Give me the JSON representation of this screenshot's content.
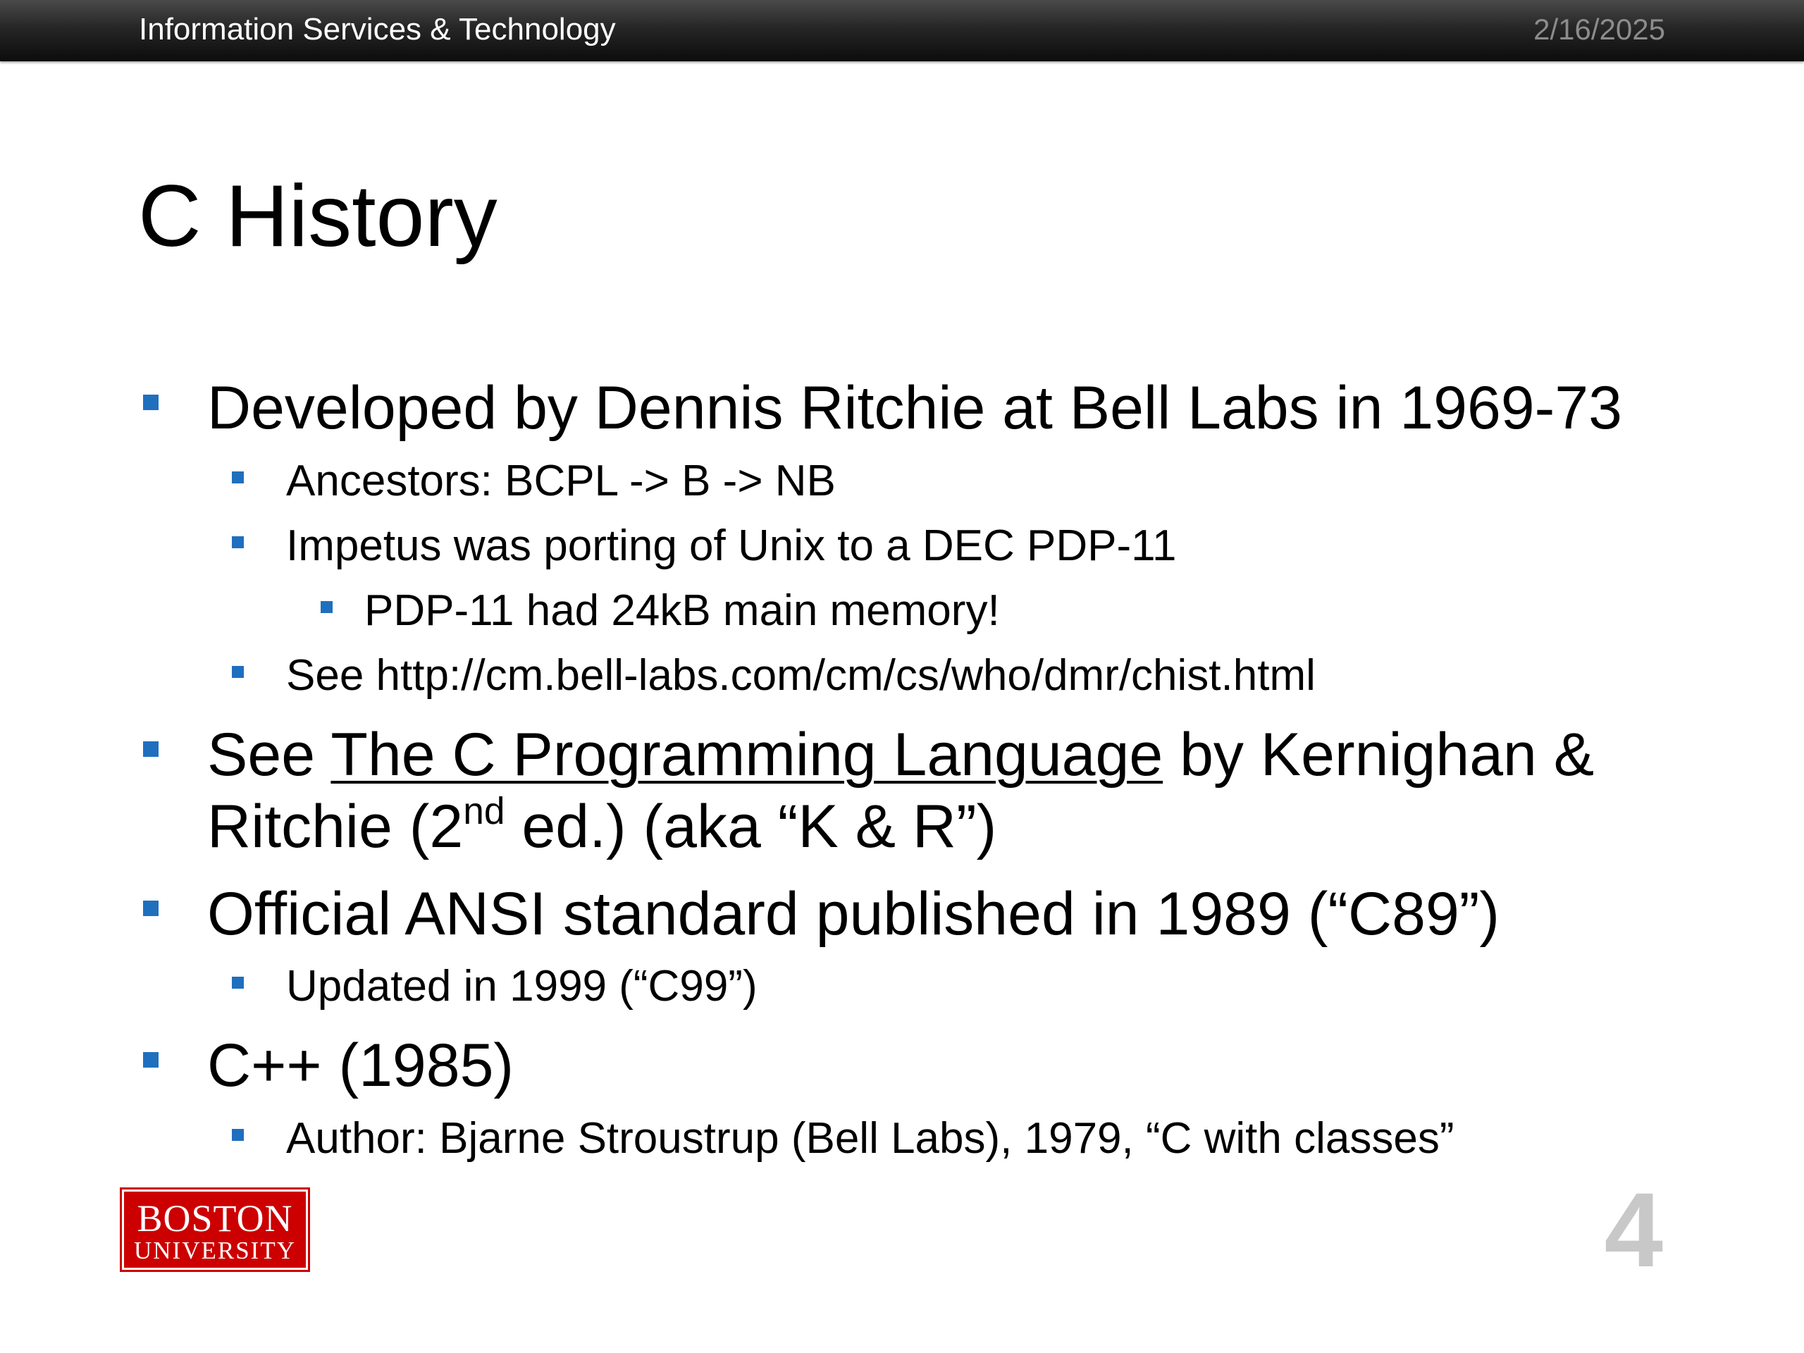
{
  "header": {
    "org_name": "Information Services & Technology",
    "date": "2/16/2025"
  },
  "slide": {
    "title": "C History",
    "page_number": "4"
  },
  "bullets": {
    "b1": "Developed by Dennis Ritchie at Bell Labs in 1969-73",
    "b1_1": "Ancestors: BCPL -> B -> NB",
    "b1_2": "Impetus was porting of Unix to a DEC PDP-11",
    "b1_2_1": "PDP-11 had 24kB main memory!",
    "b1_3": "See http://cm.bell-labs.com/cm/cs/who/dmr/chist.html",
    "b2_see": "See",
    "b2_book": "The C Programming Language",
    "b2_by": "by Kernighan &",
    "b2_line2_pre": "Ritchie (2",
    "b2_sup": "nd",
    "b2_line2_post": "ed.) (aka “K & R”)",
    "b3": "Official ANSI standard published in 1989 (“C89”)",
    "b3_1": "Updated in 1999 (“C99”)",
    "b4": "C++ (1985)",
    "b4_1": "Author: Bjarne Stroustrup (Bell Labs), 1979, “C with classes”"
  },
  "logo": {
    "line1": "BOSTON",
    "line2": "UNIVERSITY"
  },
  "colors": {
    "bullet_marker": "#1f6fbf",
    "logo_red": "#cc0000",
    "header_dark": "#1a1a1a",
    "date_gray": "#8c8c8c",
    "page_number_gray": "#c8c8c8"
  }
}
